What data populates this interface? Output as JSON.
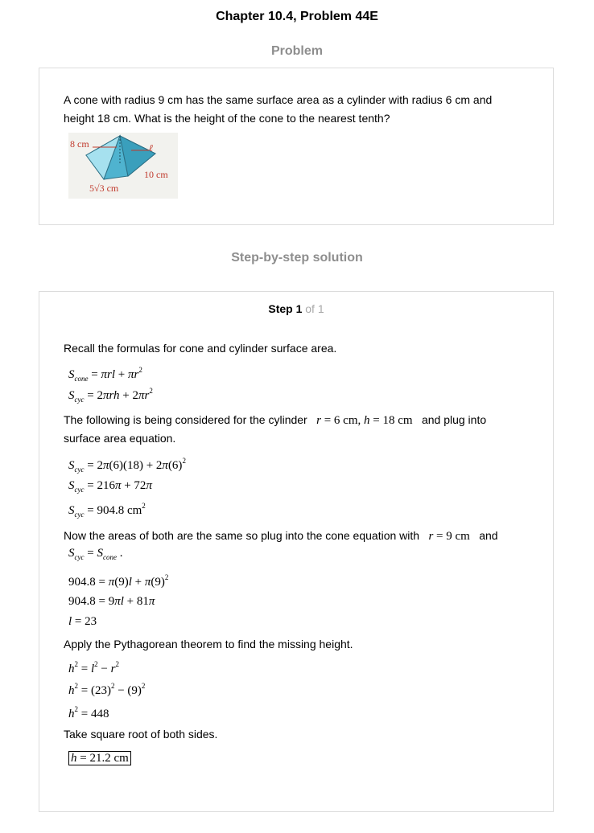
{
  "header": {
    "title": "Chapter 10.4, Problem 44E"
  },
  "problem": {
    "heading": "Problem",
    "text_line1": "A cone with radius 9 cm has the same surface area as a cylinder with radius 6 cm and",
    "text_line2": "height 18 cm. What is the height of the cone to the nearest tenth?",
    "figure": {
      "label_radius": "8 cm",
      "label_slant": "ℓ",
      "label_edge": "10 cm",
      "label_base": "5√3 cm"
    }
  },
  "solution": {
    "heading": "Step-by-step solution",
    "step_word": "Step 1",
    "step_of": "of 1",
    "t1": "Recall the formulas for cone and cylinder surface area.",
    "t2a": "The following is being considered for the cylinder",
    "t2b": "and plug into",
    "t2c": "surface area equation.",
    "t3a": "Now the areas of both are the same so plug into the cone equation with",
    "t3b": "and",
    "t4": "Apply the Pythagorean theorem to find the missing height.",
    "t5": "Take square root of both sides."
  },
  "colors": {
    "heading_gray": "#8e8e8e",
    "border": "#dcdcdc",
    "figure_label": "#c0392b"
  }
}
